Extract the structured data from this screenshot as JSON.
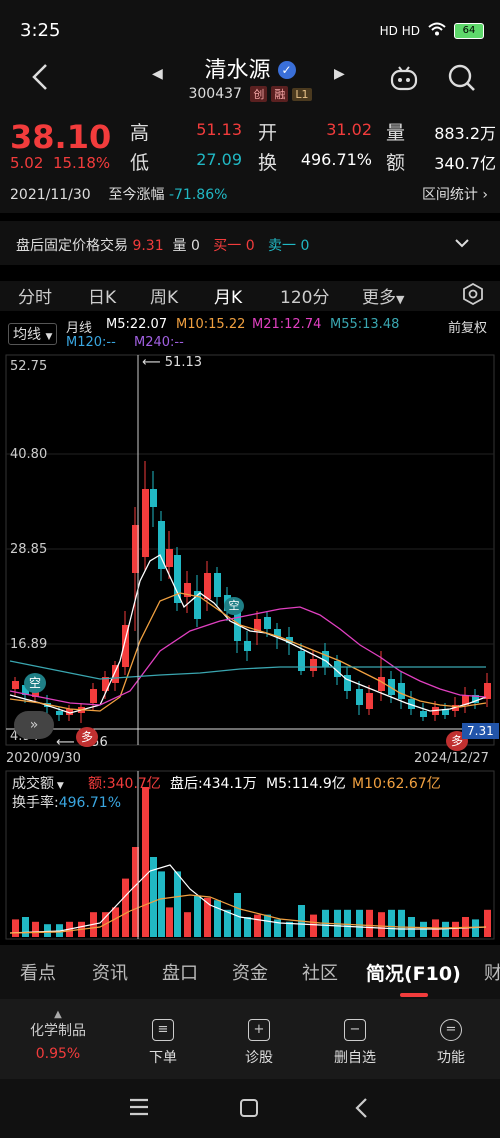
{
  "status_bar": {
    "time": "3:25",
    "signal": "HD HD",
    "battery": "64"
  },
  "header": {
    "stock_name": "清水源",
    "stock_code": "300437",
    "tags": [
      "创",
      "融",
      "L1"
    ]
  },
  "quote": {
    "price": "38.10",
    "change": "5.02",
    "change_pct": "15.18%",
    "high_label": "高",
    "high_value": "51.13",
    "open_label": "开",
    "open_value": "31.02",
    "volume_label": "量",
    "volume_value": "883.2万",
    "low_label": "低",
    "low_value": "27.09",
    "turnover_label": "换",
    "turnover_value": "496.71%",
    "amount_label": "额",
    "amount_value": "340.7亿",
    "date": "2021/11/30",
    "since_label": "至今涨幅",
    "since_value": "-71.86%",
    "range_stat": "区间统计"
  },
  "after_hours": {
    "label": "盘后固定价格交易",
    "price": "9.31",
    "vol_label": "量",
    "vol": "0",
    "buy_label": "买一",
    "buy": "0",
    "sell_label": "卖一",
    "sell": "0"
  },
  "period_tabs": [
    "分时",
    "日K",
    "周K",
    "月K",
    "120分",
    "更多"
  ],
  "chart": {
    "indicator": "均线",
    "period_label": "月线",
    "ma5": "M5:22.07",
    "ma10": "M10:15.22",
    "ma21": "M21:12.74",
    "ma55": "M55:13.48",
    "ma120": "M120:--",
    "ma240": "M240:--",
    "adjust": "前复权",
    "y_labels": [
      "52.75",
      "40.80",
      "28.85",
      "16.89",
      "4.94"
    ],
    "high_marker": "51.13",
    "low_marker": "6.56",
    "last_price": "7.31",
    "date_start": "2020/09/30",
    "date_end": "2024/12/27",
    "tag_kong": "空",
    "tag_duo": "多",
    "colors": {
      "up": "#f23c3c",
      "down": "#21b8c4",
      "ma5": "#ffffff",
      "ma10": "#f0a040",
      "ma21": "#e040c0",
      "ma55": "#3aa6b0"
    }
  },
  "volume": {
    "indicator": "成交额",
    "amount": "额:340.7亿",
    "after": "盘后:434.1万",
    "m5": "M5:114.9亿",
    "m10": "M10:62.67亿",
    "turnover_label": "换手率:",
    "turnover_value": "496.71%"
  },
  "info_tabs": [
    "看点",
    "资讯",
    "盘口",
    "资金",
    "社区",
    "简况(F10)",
    "财"
  ],
  "action_bar": {
    "sector_name": "化学制品",
    "sector_change": "0.95%",
    "actions": [
      "下单",
      "诊股",
      "删自选",
      "功能"
    ]
  }
}
